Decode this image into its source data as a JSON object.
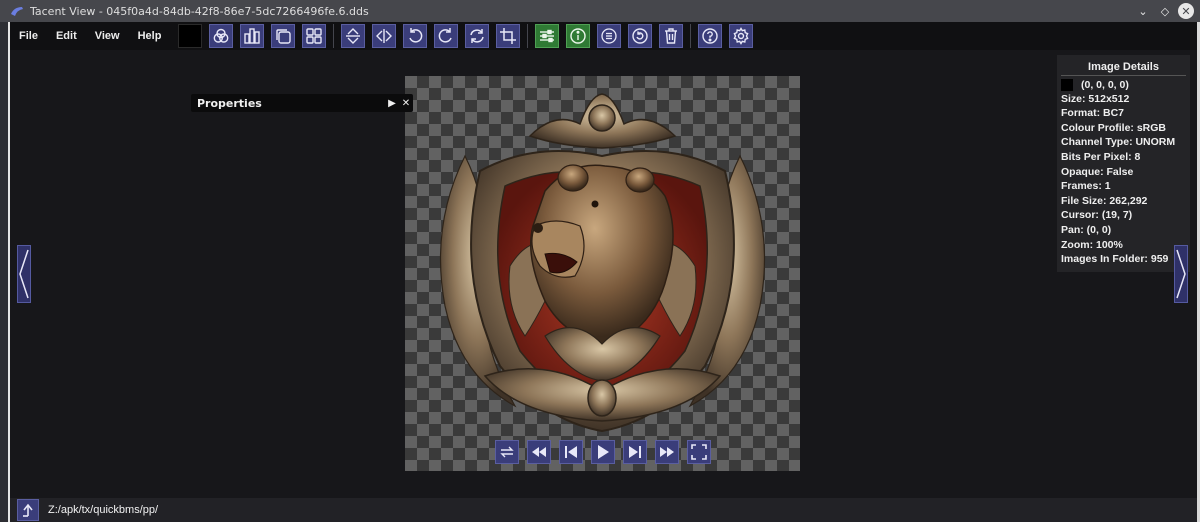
{
  "window": {
    "title": "Tacent View - 045f0a4d-84db-42f8-86e7-5dc7266496fe.6.dds",
    "controls": [
      "chevron-down-icon",
      "diamond-icon",
      "close-icon"
    ]
  },
  "menu": {
    "file": "File",
    "edit": "Edit",
    "view": "View",
    "help": "Help"
  },
  "toolbar": {
    "current_color": "#000000",
    "groups": [
      [
        "channels-icon",
        "histogram-icon",
        "tile-icon",
        "contact-sheet-icon"
      ],
      [
        "flip-vertical-icon",
        "flip-horizontal-icon",
        "rotate-ccw-icon",
        "rotate-cw-icon",
        "rotate-any-icon",
        "crop-icon"
      ],
      [
        "adjust-icon",
        "info-icon",
        "list-icon",
        "refresh-icon",
        "delete-icon"
      ],
      [
        "help-icon",
        "settings-icon"
      ]
    ]
  },
  "properties": {
    "label": "Properties"
  },
  "details": {
    "header": "Image   Details",
    "pixel_value": "(0, 0, 0, 0)",
    "rows": [
      "Size: 512x512",
      "Format: BC7",
      "Colour Profile: sRGB",
      "Channel Type: UNORM",
      "Bits Per Pixel: 8",
      "Opaque: False",
      "Frames: 1",
      "File Size: 262,292",
      "Cursor: (19, 7)",
      "Pan: (0, 0)",
      "Zoom: 100%",
      "Images In Folder: 959"
    ]
  },
  "playback": [
    "loop-icon",
    "skip-start-icon",
    "prev-frame-icon",
    "play-icon",
    "next-frame-icon",
    "skip-end-icon",
    "fullscreen-icon"
  ],
  "statusbar": {
    "path": "Z:/apk/tx/quickbms/pp/"
  },
  "colors": {
    "button_bg": "#3a3d7a",
    "button_border": "#5a5ea0",
    "green_button": "#2f7a34",
    "canvas_bg": "#17171a"
  }
}
